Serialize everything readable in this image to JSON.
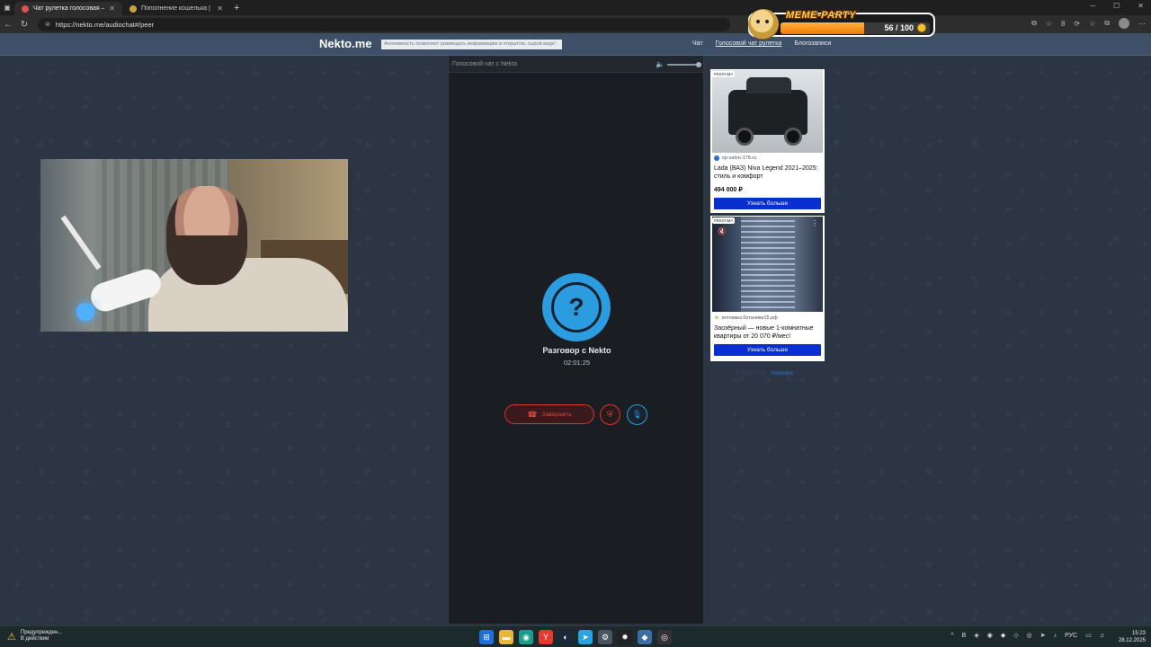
{
  "browser": {
    "tabs": [
      {
        "label": "Чат рулетка голосовая — Н",
        "active": true
      },
      {
        "label": "Пополнение кошелька | Dragon",
        "active": false
      }
    ],
    "url": "https://nekto.me/audiochat#/peer",
    "extension_count": "8"
  },
  "overlay": {
    "title": "MEME-PARTY",
    "progress_text": "56 / 100",
    "progress_value": 56,
    "progress_max": 100
  },
  "site": {
    "logo": "Nekto.me",
    "tagline": "Анонимность позволяет размещать информацию в открытом, сырой виде!",
    "nav": [
      "Чат",
      "Голосовой чат рулетка",
      "Блогозаписи"
    ]
  },
  "chat": {
    "header": "Голосовой чат с Nekto",
    "conversation_title": "Разговор с Nekto",
    "timer": "02:01:25",
    "end_label": "Завершить"
  },
  "ads": [
    {
      "tag": "РЕКЛАМА",
      "source": "sp-salon-178.ru",
      "headline": "Lada (ВАЗ) Niva Legend 2021–2025: стиль и комфорт",
      "price": "494 000 ₽",
      "cta": "Узнать больше"
    },
    {
      "tag": "РЕКЛАМА",
      "source": "котоквиз.ботаники15.рф",
      "headline": "Заозёрный — новые 1-комнатные квартиры от 20 070 ₽/мес!",
      "cta": "Узнать больше"
    }
  ],
  "footer": {
    "copy": "© 2011-2025",
    "link": "NektoMe"
  },
  "taskbar": {
    "warning_title": "Предупрежден...",
    "warning_sub": "В действии",
    "lang": "РУС",
    "time": "15:23",
    "date": "28.12.2025"
  },
  "colors": {
    "accent": "#2c9ce0",
    "danger": "#d9372f",
    "header": "#3d5068",
    "ad_button": "#0a2fd0"
  }
}
